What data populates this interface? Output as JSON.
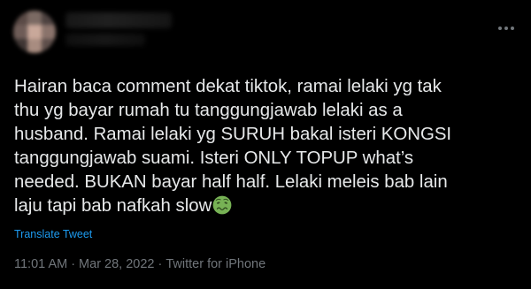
{
  "tweet": {
    "text_lines": [
      "Hairan baca comment dekat tiktok, ramai lelaki yg tak",
      "thu yg bayar rumah tu tanggungjawab lelaki as a",
      "husband. Ramai lelaki yg SURUH bakal isteri KONGSI",
      "tanggungjawab suami. Isteri ONLY TOPUP what’s",
      "needed. BUKAN bayar half half. Lelaki meleis bab lain",
      "laju tapi bab nafkah slow"
    ],
    "emoji": "nauseated-face-icon",
    "translate_label": "Translate Tweet",
    "time": "11:01 AM",
    "date": "Mar 28, 2022",
    "source": "Twitter for iPhone",
    "separator": "·"
  },
  "colors": {
    "background": "#000000",
    "text": "#e7e9ea",
    "link": "#1d9bf0",
    "muted": "#71767b"
  },
  "icons": {
    "more": "more-horizontal-icon",
    "avatar": "avatar-blurred"
  }
}
